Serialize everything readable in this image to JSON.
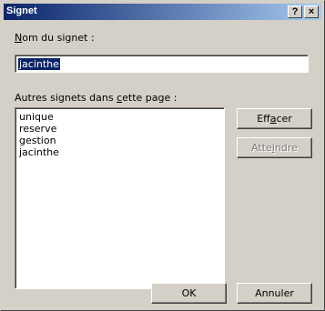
{
  "window": {
    "title": "Signet",
    "help_label": "?",
    "close_label": "×"
  },
  "name_field": {
    "label_mnemonic": "N",
    "label_rest": "om du signet :",
    "value": "jacinthe"
  },
  "list": {
    "label_before": "Autres signets dans ",
    "label_mnemonic": "c",
    "label_after": "ette page :",
    "items": [
      "unique",
      "reserve",
      "gestion",
      "jacinthe"
    ]
  },
  "buttons": {
    "delete": {
      "before": "Eff",
      "mnemonic": "a",
      "after": "cer"
    },
    "goto": {
      "before": "Atte",
      "mnemonic": "i",
      "after": "ndre",
      "disabled": true
    },
    "ok": "OK",
    "cancel": "Annuler"
  }
}
